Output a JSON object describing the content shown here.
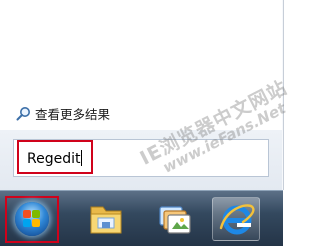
{
  "start_menu": {
    "see_more_results": "查看更多结果",
    "search_input": {
      "value": "Regedit"
    }
  },
  "watermark": {
    "line1": "IE浏览器中文网站",
    "line2": "www.ieFans.Net"
  },
  "taskbar": {
    "items": [
      {
        "name": "Windows Explorer",
        "icon": "folder-icon"
      },
      {
        "name": "Windows Media Center",
        "icon": "media-icon"
      },
      {
        "name": "Internet Explorer",
        "icon": "ie-icon"
      }
    ]
  },
  "colors": {
    "highlight_border": "#d0021b",
    "taskbar": "#2b3e53",
    "ie_blue": "#1e88e5"
  }
}
